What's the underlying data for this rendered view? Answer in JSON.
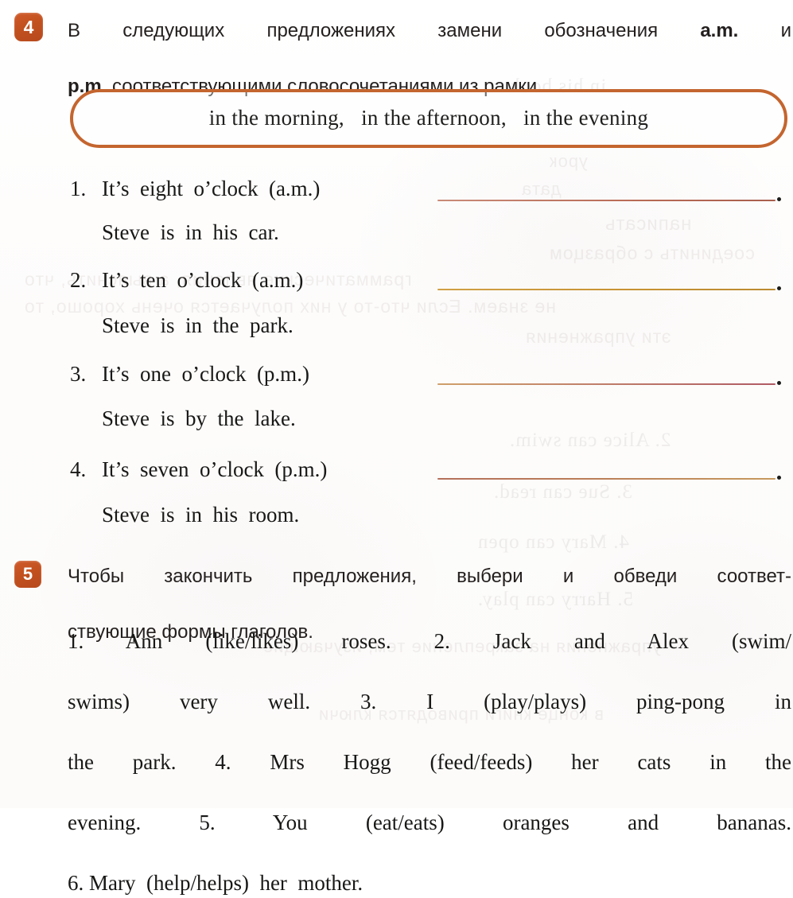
{
  "page": {
    "background_color": "#fdfdfc",
    "accent_color": "#c2511f",
    "box_border_color": "#c4652f",
    "text_color": "#181817"
  },
  "exercise4": {
    "number": "4",
    "instruction_line1": "В  следующих  предложениях  замени  обозначения ",
    "instruction_bold1": "a.m.",
    "instruction_line1_tail": "  и",
    "instruction_bold2": "p.m.",
    "instruction_line2_tail": " соответствующими словосочетаниями из рамки.",
    "word_bank": "in the morning,   in the afternoon,   in the evening",
    "word_bank_options": [
      "in the morning,",
      "in the afternoon,",
      "in the evening"
    ],
    "items": [
      {
        "number": "1.",
        "question": "It’s  eight  o’clock  (a.m.)",
        "answer_sentence": "Steve  is  in  his  car.",
        "blank_color_start": "#c98b78",
        "blank_color_end": "#b86a55",
        "blank_end_mark": "."
      },
      {
        "number": "2.",
        "question": "It’s  ten  o’clock  (a.m.)",
        "answer_sentence": "Steve  is  in  the  park.",
        "blank_color_start": "#cf9a3c",
        "blank_color_end": "#c08c33",
        "blank_end_mark": "."
      },
      {
        "number": "3.",
        "question": "It’s  one  o’clock  (p.m.)",
        "answer_sentence": "Steve  is  by  the  lake.",
        "blank_color_start": "#cfa06a",
        "blank_color_end": "#b05a63",
        "blank_end_mark": "."
      },
      {
        "number": "4.",
        "question": "It’s  seven  o’clock  (p.m.)",
        "answer_sentence": "Steve  is  in  his  room.",
        "blank_color_start": "#b5705a",
        "blank_color_end": "#c79a5e",
        "blank_end_mark": "."
      }
    ]
  },
  "exercise5": {
    "number": "5",
    "instruction_line1": "Чтобы закончить предложения, выбери и обведи соответ-",
    "instruction_line2": "ствующие формы глаголов.",
    "body_line1": "1.  Ann  (like/likes)  roses.  2.  Jack  and  Alex  (swim/",
    "body_line2": "swims)  very  well.  3.  I  (play/plays)  ping-pong  in",
    "body_line3": "the  park.  4.  Mrs  Hogg  (feed/feeds)  her  cats  in  the",
    "body_line4": "evening.  5.  You  (eat/eats)  oranges  and  bananas.",
    "body_line5": "6. Mary  (help/helps)  her  mother.",
    "sentences": [
      "1. Ann (like/likes) roses.",
      "2. Jack and Alex (swim/swims) very well.",
      "3. I (play/plays) ping-pong in the park.",
      "4. Mrs Hogg (feed/feeds) her cats in the evening.",
      "5. You (eat/eats) oranges and bananas.",
      "6. Mary (help/helps) her mother."
    ]
  },
  "bleed_through": {
    "b1": "in his book",
    "b2": "урок",
    "b3": "дата",
    "b4": "написать",
    "b5": "соединить с образцом",
    "b6": "грамматические явления, а выяснить, что",
    "b7": "не знаем. Если что-то у них получается очень хорошо, то",
    "b8": "эти упражнения",
    "b9": "2. Alice can swim.",
    "b10": "3. Sue can read.",
    "b11": "4. Mary can open",
    "b12": "5. Harry can play.",
    "b13": "упражнения на закрепление тем, изучающие",
    "b14": "в конце книги приводятся ключи"
  }
}
